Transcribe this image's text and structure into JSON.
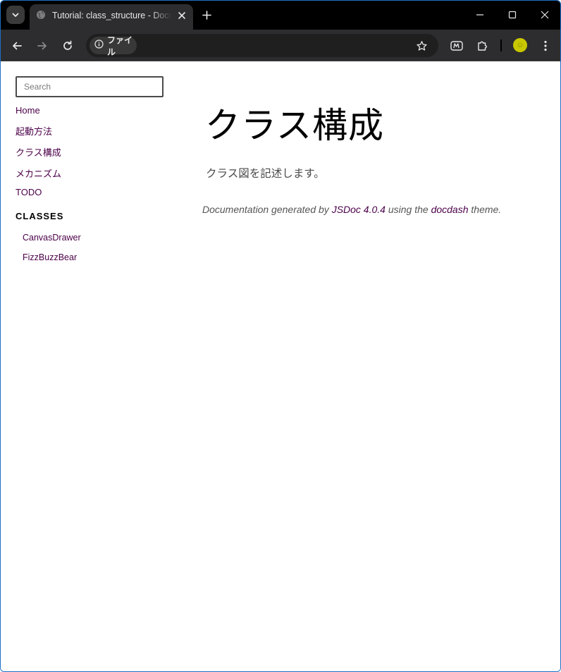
{
  "browser": {
    "tab_title": "Tutorial: class_structure - Documentation",
    "site_chip_label": "ファイル",
    "colors": {
      "tabstrip": "#000000",
      "toolbar": "#2d2d2f",
      "avatar": "#c9c800"
    },
    "icons": [
      "tab-search-icon",
      "globe-icon",
      "close-icon",
      "plus-icon",
      "minimize-icon",
      "maximize-icon",
      "window-close-icon",
      "back-icon",
      "forward-icon",
      "reload-icon",
      "info-icon",
      "star-icon",
      "extension-m-icon",
      "puzzle-icon",
      "avatar",
      "kebab-menu-icon"
    ]
  },
  "sidebar": {
    "search_placeholder": "Search",
    "links": [
      {
        "label": "Home"
      },
      {
        "label": "起動方法"
      },
      {
        "label": "クラス構成"
      },
      {
        "label": "メカニズム"
      },
      {
        "label": "TODO"
      }
    ],
    "classes_heading": "CLASSES",
    "classes": [
      {
        "label": "CanvasDrawer"
      },
      {
        "label": "FizzBuzzBear"
      }
    ],
    "link_color": "#4b0049"
  },
  "main": {
    "title": "クラス構成",
    "description": "クラス図を記述します。",
    "footer": {
      "prefix": "Documentation generated by ",
      "jsdoc_link": "JSDoc 4.0.4",
      "middle": " using the ",
      "theme_link": "docdash",
      "suffix": " theme."
    }
  }
}
